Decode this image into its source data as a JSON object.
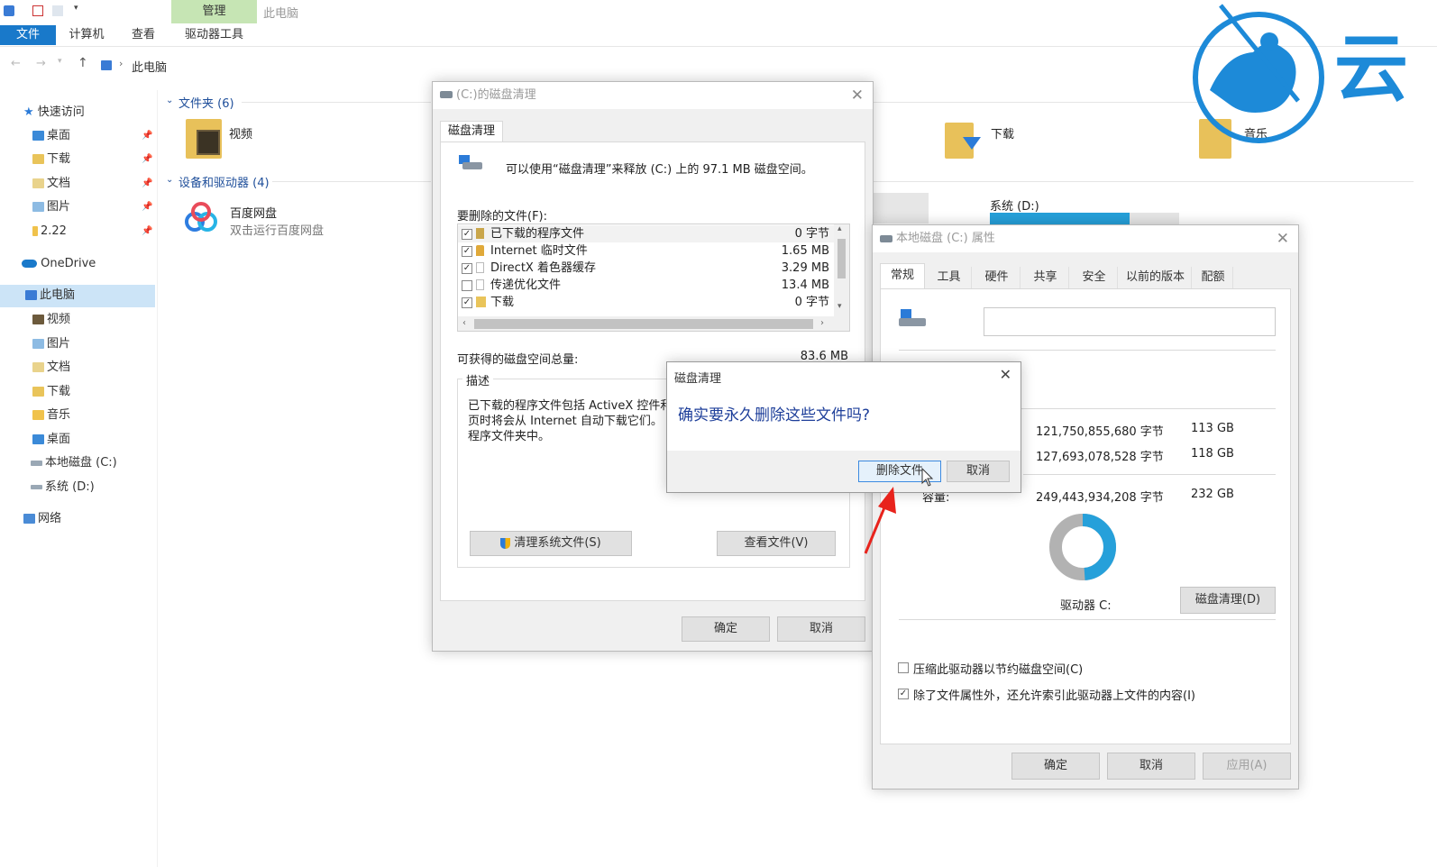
{
  "ribbon": {
    "manage_tab": "管理",
    "title": "此电脑",
    "tabs": [
      "文件",
      "计算机",
      "查看",
      "驱动器工具"
    ]
  },
  "address": {
    "path": "此电脑"
  },
  "nav": {
    "quick_access": "快速访问",
    "quick_items": [
      "桌面",
      "下载",
      "文档",
      "图片",
      "2.22"
    ],
    "onedrive": "OneDrive",
    "this_pc": "此电脑",
    "pc_items": [
      "视频",
      "图片",
      "文档",
      "下载",
      "音乐",
      "桌面",
      "本地磁盘 (C:)",
      "系统 (D:)"
    ],
    "network": "网络"
  },
  "content": {
    "folders_header": "文件夹 (6)",
    "devices_header": "设备和驱动器 (4)",
    "folders": [
      "视频",
      "下载",
      "音乐"
    ],
    "baidu_name": "百度网盘",
    "baidu_sub": "双击运行百度网盘",
    "drive_d_label": "系统 (D:)"
  },
  "cleanup": {
    "title": "(C:)的磁盘清理",
    "tab": "磁盘清理",
    "intro": "可以使用“磁盘清理”来释放 (C:) 上的 97.1 MB 磁盘空间。",
    "files_label": "要删除的文件(F):",
    "files": [
      {
        "name": "已下载的程序文件",
        "size": "0 字节",
        "checked": true
      },
      {
        "name": "Internet 临时文件",
        "size": "1.65 MB",
        "checked": true
      },
      {
        "name": "DirectX 着色器缓存",
        "size": "3.29 MB",
        "checked": true
      },
      {
        "name": "传递优化文件",
        "size": "13.4 MB",
        "checked": false
      },
      {
        "name": "下载",
        "size": "0 字节",
        "checked": true
      }
    ],
    "total_label": "可获得的磁盘空间总量:",
    "total_value": "83.6 MB",
    "desc_label": "描述",
    "desc_lines": [
      "已下载的程序文件包括 ActiveX 控件和",
      "页时将会从 Internet 自动下载它们。",
      "程序文件夹中。"
    ],
    "clean_sys_button": "清理系统文件(S)",
    "view_files_button": "查看文件(V)",
    "ok": "确定",
    "cancel": "取消"
  },
  "properties": {
    "title": "本地磁盘 (C:) 属性",
    "tabs": [
      "常规",
      "工具",
      "硬件",
      "共享",
      "安全",
      "以前的版本",
      "配额"
    ],
    "used_bytes": "121,750,855,680 字节",
    "used_gb": "113 GB",
    "free_bytes": "127,693,078,528 字节",
    "free_gb": "118 GB",
    "capacity_label": "容量:",
    "cap_bytes": "249,443,934,208 字节",
    "cap_gb": "232 GB",
    "drive_label": "驱动器 C:",
    "cleanup_button": "磁盘清理(D)",
    "compress": "压缩此驱动器以节约磁盘空间(C)",
    "index": "除了文件属性外，还允许索引此驱动器上文件的内容(I)",
    "ok": "确定",
    "cancel": "取消",
    "apply": "应用(A)",
    "used_fraction": 0.488
  },
  "confirm": {
    "title": "磁盘清理",
    "question": "确实要永久删除这些文件吗?",
    "delete_button": "删除文件",
    "cancel_button": "取消"
  },
  "watermark": {
    "char": "云"
  },
  "colors": {
    "accent": "#1979ca",
    "win_bg": "#f0f0f0",
    "manage_green": "#c6e5b4"
  }
}
